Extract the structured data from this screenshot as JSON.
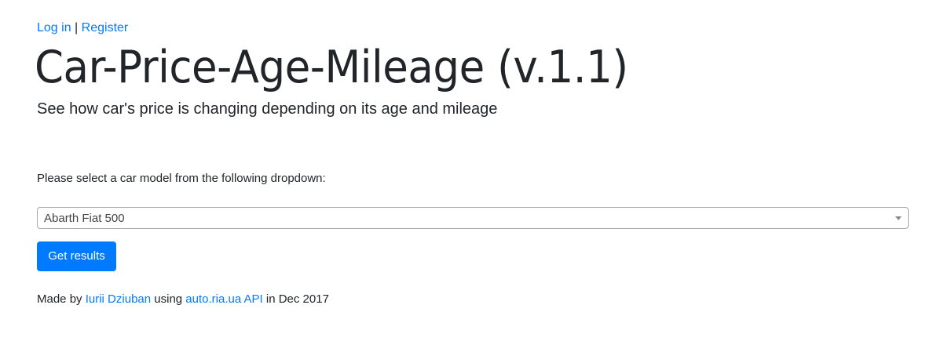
{
  "auth": {
    "login_label": "Log in",
    "separator": "|",
    "register_label": "Register"
  },
  "header": {
    "title": "Car-Price-Age-Mileage (v.1.1)",
    "subtitle": "See how car's price is changing depending on its age and mileage"
  },
  "form": {
    "prompt": "Please select a car model from the following dropdown:",
    "selected_model": "Abarth Fiat 500",
    "submit_label": "Get results"
  },
  "footer": {
    "made_by_prefix": "Made by",
    "author_name": "Iurii Dziuban",
    "using_text": "using",
    "api_link_text": "auto.ria.ua API",
    "date_suffix": "in Dec 2017"
  },
  "colors": {
    "link": "#007bff",
    "button_bg": "#007bff",
    "text": "#212529"
  },
  "icons": {
    "dropdown": "caret-down-icon"
  }
}
